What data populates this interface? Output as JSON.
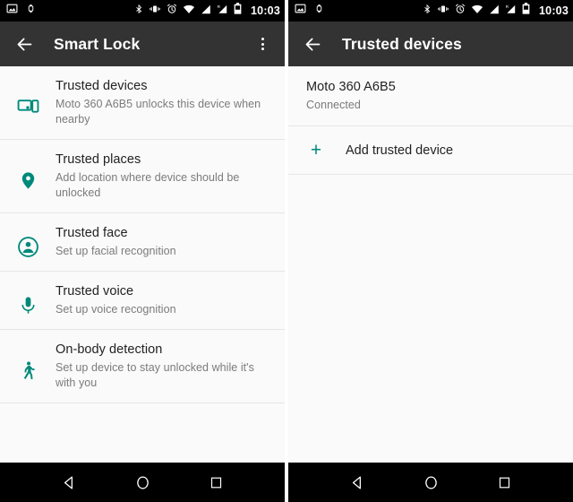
{
  "status_bar": {
    "left_icons": [
      "screenshot-icon",
      "watch-icon"
    ],
    "right_icons": [
      "bluetooth-icon",
      "vibrate-icon",
      "alarm-icon",
      "wifi-icon",
      "signal-icon",
      "roaming-signal-icon",
      "battery-icon"
    ],
    "time": "10:03",
    "background": "#000000"
  },
  "left_screen": {
    "toolbar": {
      "back_icon": "arrow-back-icon",
      "title": "Smart Lock",
      "overflow_icon": "overflow-menu-icon",
      "background": "#333333"
    },
    "items": [
      {
        "icon": "devices-icon",
        "title": "Trusted devices",
        "subtitle": "Moto 360 A6B5 unlocks this device when nearby"
      },
      {
        "icon": "location-pin-icon",
        "title": "Trusted places",
        "subtitle": "Add location where device should be unlocked"
      },
      {
        "icon": "account-circle-icon",
        "title": "Trusted face",
        "subtitle": "Set up facial recognition"
      },
      {
        "icon": "microphone-icon",
        "title": "Trusted voice",
        "subtitle": "Set up voice recognition"
      },
      {
        "icon": "walking-person-icon",
        "title": "On-body detection",
        "subtitle": "Set up device to stay unlocked while it's with you"
      }
    ]
  },
  "right_screen": {
    "toolbar": {
      "back_icon": "arrow-back-icon",
      "title": "Trusted devices",
      "background": "#333333"
    },
    "device": {
      "title": "Moto 360 A6B5",
      "subtitle": "Connected"
    },
    "add_action": {
      "plus_icon": "+",
      "label": "Add trusted device"
    }
  },
  "nav_bar": {
    "back": "back-triangle-icon",
    "home": "home-circle-icon",
    "recents": "recents-square-icon",
    "background": "#000000"
  },
  "colors": {
    "accent_teal": "#00897b",
    "surface": "#fafafa",
    "toolbar": "#333333",
    "primary_text": "#222222",
    "secondary_text": "#7b7b7b",
    "divider": "#e6e6e6"
  }
}
